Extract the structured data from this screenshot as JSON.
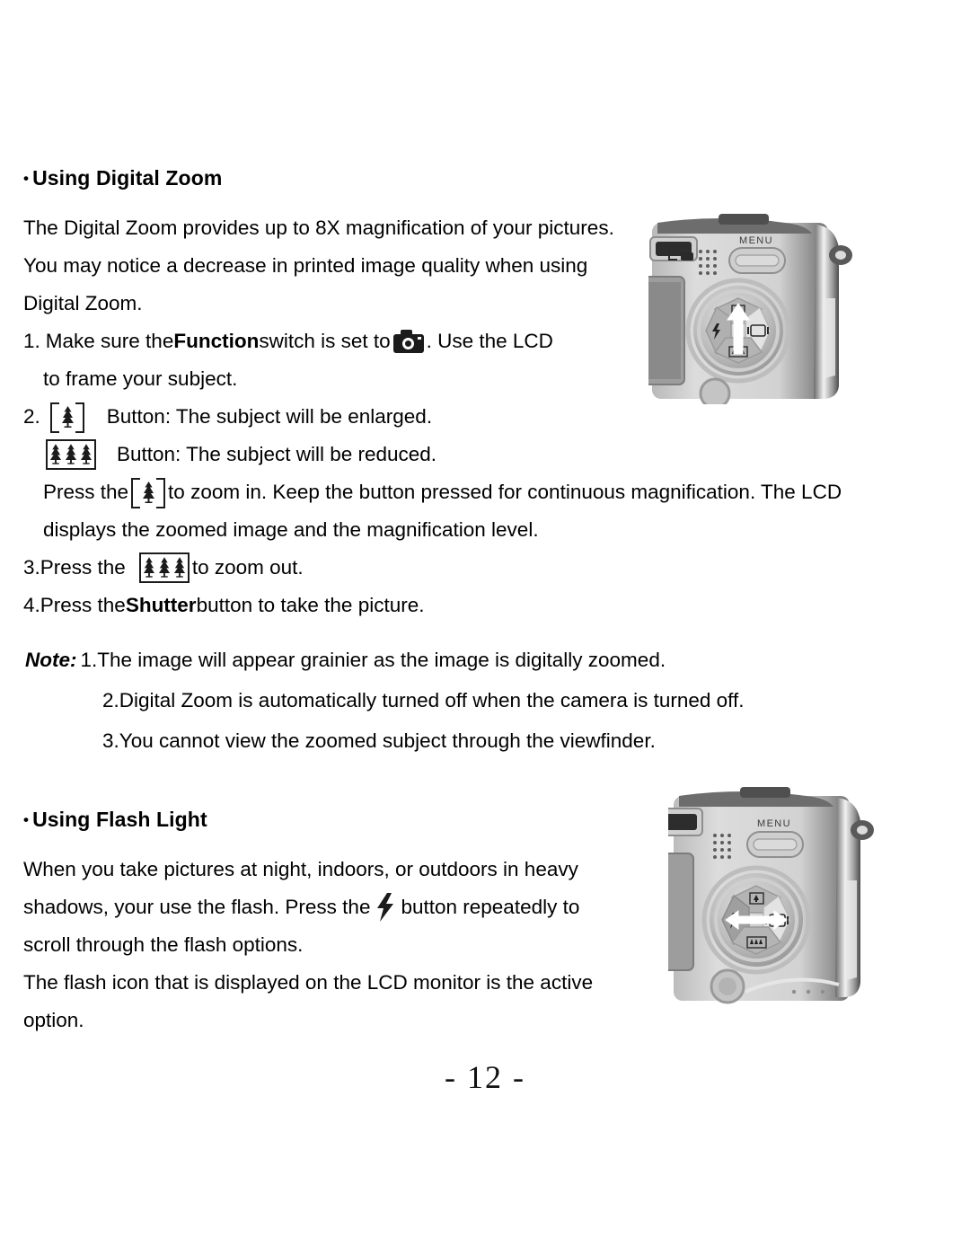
{
  "document": {
    "page_number": "- 12 -"
  },
  "sections": [
    {
      "id": "digital-zoom",
      "bullet": "•",
      "heading": "Using Digital Zoom",
      "intro": [
        "The Digital Zoom provides up to 8X magnification of your pictures.",
        "You may notice a decrease in printed image quality when using",
        "Digital Zoom."
      ],
      "steps": {
        "step1_num": "1.",
        "step1_a": "Make sure the ",
        "step1_bold": "Function",
        "step1_b": " switch is set to ",
        "step1_icon": "camera-icon",
        "step1_c": ". Use the LCD",
        "step1_cont": "to frame your subject.",
        "step2_num": "2.",
        "step2_icon_tele": "telephoto-tree-icon",
        "step2_tele_text": "Button: The subject will be enlarged.",
        "step2_icon_wide": "wide-angle-trees-icon",
        "step2_wide_text": "Button: The subject will be reduced.",
        "press_a": "Press the",
        "press_icon": "telephoto-tree-icon",
        "press_b": "to zoom in. Keep the button pressed for continuous magnification. The LCD",
        "press_cont": "displays the zoomed image and the magnification level.",
        "step3_num": "3.",
        "step3_a": "Press the ",
        "step3_icon": "wide-angle-trees-icon",
        "step3_b": "to zoom out.",
        "step4_num": "4.",
        "step4_a": "Press the ",
        "step4_bold": "Shutter",
        "step4_b": " button to take the picture."
      },
      "note": {
        "label": "Note:",
        "items": [
          "1.The image will appear grainier as the image is digitally zoomed.",
          "2.Digital Zoom is automatically turned off when the camera is turned off.",
          "3.You cannot view the zoomed subject through the viewfinder."
        ]
      }
    },
    {
      "id": "flash-light",
      "bullet": "•",
      "heading": "Using Flash Light",
      "body": {
        "line1": "When you take pictures at night, indoors, or outdoors in heavy",
        "line2_a": "shadows, your use the flash. Press the",
        "line2_icon": "flash-bolt-icon",
        "line2_b": "button repeatedly to",
        "line3": "scroll through the flash options.",
        "line4": "The flash icon that is displayed on the LCD monitor is the active",
        "line5": "option."
      }
    }
  ],
  "photos": [
    {
      "id": "camera-back-zoom",
      "alt": "Camera back view with MENU button and four-way pad, white arrow pointing up to telephoto button",
      "menu_label": "MENU",
      "arrow": "up-arrow",
      "pad_icons": [
        "telephoto-tree-icon",
        "flash-bolt-icon",
        "display-lcd-icon",
        "wide-angle-trees-icon"
      ]
    },
    {
      "id": "camera-back-flash",
      "alt": "Camera back view with MENU button and four-way pad, white arrow pointing left to flash button",
      "menu_label": "MENU",
      "arrow": "left-right-arrow",
      "pad_icons": [
        "telephoto-tree-icon",
        "flash-bolt-icon",
        "display-lcd-icon",
        "wide-angle-trees-icon"
      ]
    }
  ],
  "colors": {
    "text": "#000000",
    "page_background": "#ffffff",
    "icon_fill": "#1b1b1b",
    "photo_body_light": "#d8d8d8",
    "photo_body_mid": "#a9a9a9",
    "photo_body_dark": "#4a4a4a"
  }
}
